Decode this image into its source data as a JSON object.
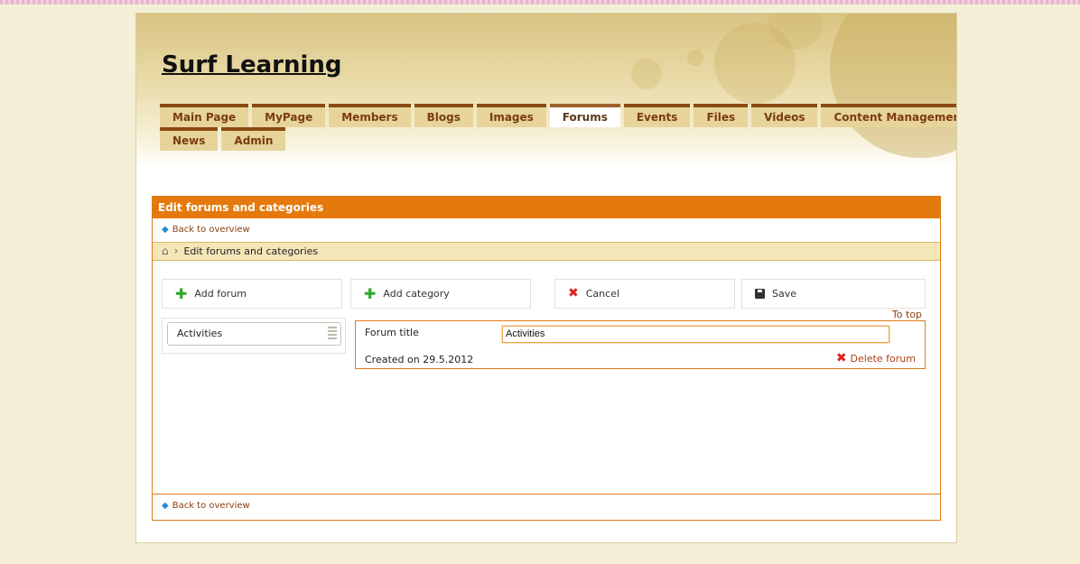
{
  "site": {
    "title": "Surf Learning"
  },
  "nav": {
    "row1": [
      "Main Page",
      "MyPage",
      "Members",
      "Blogs",
      "Images",
      "Forums",
      "Events",
      "Files",
      "Videos",
      "Content Management"
    ],
    "row2": [
      "News",
      "Admin"
    ],
    "active": "Forums"
  },
  "panel": {
    "title": "Edit forums and categories",
    "back_top": "Back to overview",
    "back_bottom": "Back to overview",
    "breadcrumb": "Edit forums and categories"
  },
  "toolbar": {
    "add_forum": "Add forum",
    "add_category": "Add category",
    "cancel": "Cancel",
    "save": "Save"
  },
  "to_top": "To top",
  "categories": [
    "Activities"
  ],
  "forum": {
    "title_label": "Forum title",
    "title_value": "Activities",
    "created": "Created on 29.5.2012",
    "delete_label": "Delete forum"
  },
  "colors": {
    "accent": "#e47a0d",
    "tab_border": "#8a4a13",
    "tab_bg": "#e6d49b",
    "page_bg": "#f4efd6"
  },
  "icons": [
    "home-icon",
    "plus-icon",
    "cancel-x-icon",
    "save-disk-icon",
    "delete-x-icon",
    "back-arrow-icon",
    "drag-grip-icon"
  ]
}
